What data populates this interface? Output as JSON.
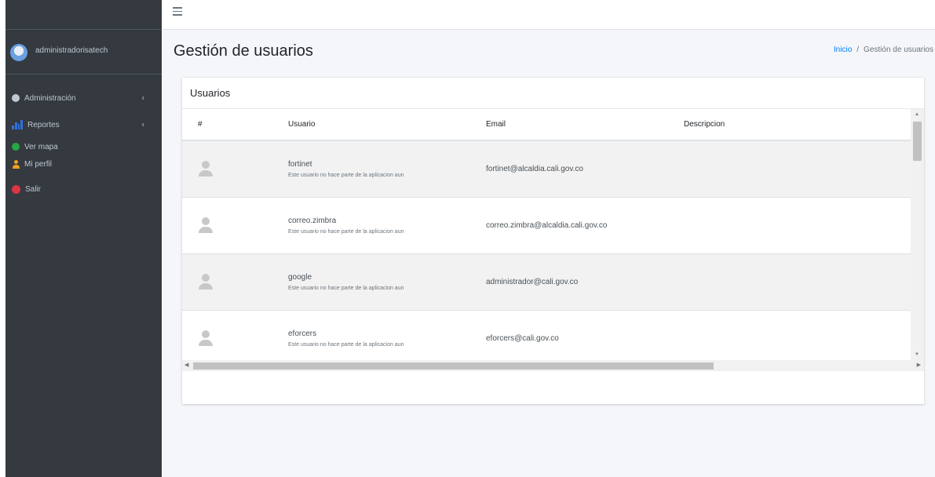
{
  "sidebar": {
    "user": "administradorisatech",
    "items": [
      {
        "label": "Administración",
        "icon": "gear-icon",
        "has_submenu": true
      },
      {
        "label": "Reportes",
        "icon": "bar-chart-icon",
        "has_submenu": true
      },
      {
        "label": "Ver mapa",
        "icon": "globe-icon",
        "has_submenu": false
      },
      {
        "label": "Mi perfil",
        "icon": "user-icon",
        "has_submenu": false
      },
      {
        "label": "Salir",
        "icon": "power-icon",
        "has_submenu": false
      }
    ],
    "submenu_chevron": "‹"
  },
  "header": {
    "menu_icon": "hamburger-icon"
  },
  "page": {
    "title": "Gestión de usuarios",
    "breadcrumb": {
      "home": "Inicio",
      "separator": "/",
      "current": "Gestión de usuarios"
    }
  },
  "card": {
    "title": "Usuarios",
    "columns": [
      "#",
      "Usuario",
      "Email",
      "Descripcion"
    ],
    "rows": [
      {
        "username": "fortinet",
        "note": "Este usuario no hace parte de la aplicacion aun",
        "email": "fortinet@alcaldia.cali.gov.co",
        "description": ""
      },
      {
        "username": "correo.zimbra",
        "note": "Este usuario no hace parte de la aplicacion aun",
        "email": "correo.zimbra@alcaldia.cali.gov.co",
        "description": ""
      },
      {
        "username": "google",
        "note": "Este usuario no hace parte de la aplicacion aun",
        "email": "administrador@cali.gov.co",
        "description": ""
      },
      {
        "username": "eforcers",
        "note": "Este usuario no hace parte de la aplicacion aun",
        "email": "eforcers@cali.gov.co",
        "description": ""
      }
    ]
  },
  "colors": {
    "sidebar_bg": "#343a40",
    "content_bg": "#f4f6f9",
    "link": "#007bff",
    "striped_row": "#f2f2f2"
  }
}
